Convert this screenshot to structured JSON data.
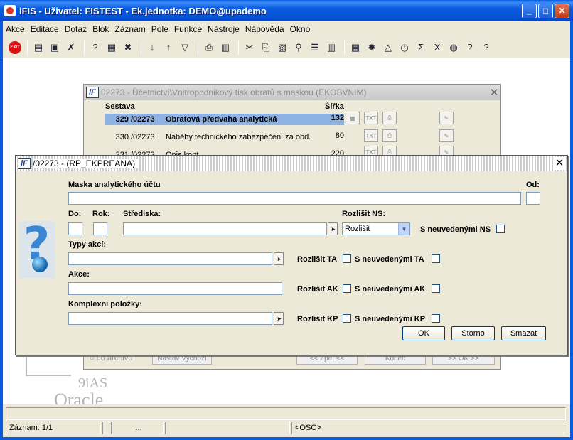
{
  "window": {
    "title": "iFIS - Uživatel: FISTEST - Ek.jednotka: DEMO@upademo"
  },
  "menu": [
    "Akce",
    "Editace",
    "Dotaz",
    "Blok",
    "Záznam",
    "Pole",
    "Funkce",
    "Nástroje",
    "Nápověda",
    "Okno"
  ],
  "toolbar": {
    "exit_label": "EXIT"
  },
  "background_dialog": {
    "title": "02273 - Účetnictví\\Vnitropodnikový tisk obratů s maskou (EKOBVNIM)",
    "col_sestava": "Sestava",
    "col_sirka": "Šířka",
    "rows": [
      {
        "num": "329",
        "code": "/02273",
        "name": "Obratová předvaha analytická",
        "width": "132"
      },
      {
        "num": "330",
        "code": "/02273",
        "name": "Náběhy technického zabezpečení za obd.",
        "width": "80"
      },
      {
        "num": "331",
        "code": "/02273",
        "name": "Opis kont",
        "width": "220"
      }
    ],
    "to_archive": "do archivu",
    "reset_button": "Nastav Výchozí",
    "back_button": "<< Zpět <<",
    "end_button": "Konec",
    "ok_button": ">> OK >>"
  },
  "logo": {
    "product": "9iAS",
    "vendor": "Oracle"
  },
  "dialog": {
    "title": "/02273 - (RP_EKPREANA)",
    "mask_label": "Maska analytického účtu",
    "mask_value": "",
    "od_label": "Od:",
    "do_label": "Do:",
    "rok_label": "Rok:",
    "strediska_label": "Střediska:",
    "rozlisit_ns_label": "Rozlišit NS:",
    "rozlisit_ns_value": "Rozlišit",
    "s_neuvedenymi_ns_label": "S neuvedenými NS",
    "typy_akci_label": "Typy akcí:",
    "rozlisit_ta_label": "Rozlišit TA",
    "s_neuvedenymi_ta_label": "S neuvedenými TA",
    "akce_label": "Akce:",
    "rozlisit_ak_label": "Rozlišit AK",
    "s_neuvedenymi_ak_label": "S neuvedenými AK",
    "komplexni_label": "Komplexní položky:",
    "rozlisit_kp_label": "Rozlišit KP",
    "s_neuvedenymi_kp_label": "S neuvedenými KP",
    "ok_button": "OK",
    "storno_button": "Storno",
    "smazat_button": "Smazat"
  },
  "statusbar": {
    "record": "Záznam: 1/1",
    "dots": "...",
    "osc": "<OSC>"
  }
}
